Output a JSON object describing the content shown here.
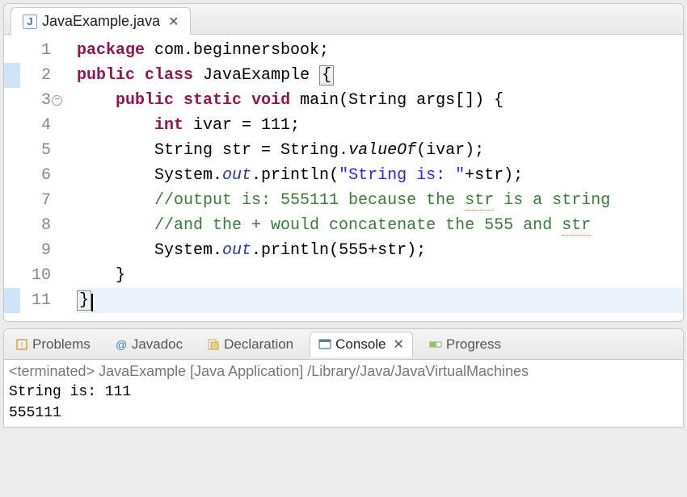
{
  "editor": {
    "tab_filename": "JavaExample.java",
    "lines": [
      {
        "n": "1",
        "marker": false,
        "fold": false
      },
      {
        "n": "2",
        "marker": true,
        "fold": false
      },
      {
        "n": "3",
        "marker": false,
        "fold": true
      },
      {
        "n": "4",
        "marker": false,
        "fold": false
      },
      {
        "n": "5",
        "marker": false,
        "fold": false
      },
      {
        "n": "6",
        "marker": false,
        "fold": false
      },
      {
        "n": "7",
        "marker": false,
        "fold": false
      },
      {
        "n": "8",
        "marker": false,
        "fold": false
      },
      {
        "n": "9",
        "marker": false,
        "fold": false
      },
      {
        "n": "10",
        "marker": false,
        "fold": false
      },
      {
        "n": "11",
        "marker": true,
        "fold": false
      }
    ],
    "code": {
      "l1_kw1": "package",
      "l1_pkg": " com.beginnersbook;",
      "l2_kw1": "public",
      "l2_kw2": "class",
      "l2_name": " JavaExample ",
      "l3_kw1": "public",
      "l3_kw2": "static",
      "l3_kw3": "void",
      "l3_rest": " main(String args[]) {",
      "l4_kw1": "int",
      "l4_rest": " ivar = 111;",
      "l5_a": "        String str = String.",
      "l5_m": "valueOf",
      "l5_b": "(ivar);",
      "l6_a": "        System.",
      "l6_f": "out",
      "l6_b": ".println(",
      "l6_s": "\"String is: \"",
      "l6_c": "+str);",
      "l7_a": "        ",
      "l7_c1": "//output is: 555111 because the ",
      "l7_sq": "str",
      "l7_c2": " is a string",
      "l8_a": "        ",
      "l8_c1": "//and the + would concatenate the 555 and ",
      "l8_sq": "str",
      "l9_a": "        System.",
      "l9_f": "out",
      "l9_b": ".println(555+str);",
      "l10": "    }",
      "l11": "}"
    }
  },
  "bottom": {
    "tabs": {
      "problems": "Problems",
      "javadoc": "Javadoc",
      "declaration": "Declaration",
      "console": "Console",
      "progress": "Progress"
    },
    "console_header": "<terminated> JavaExample [Java Application] /Library/Java/JavaVirtualMachines",
    "console_output": "String is: 111\n555111"
  }
}
